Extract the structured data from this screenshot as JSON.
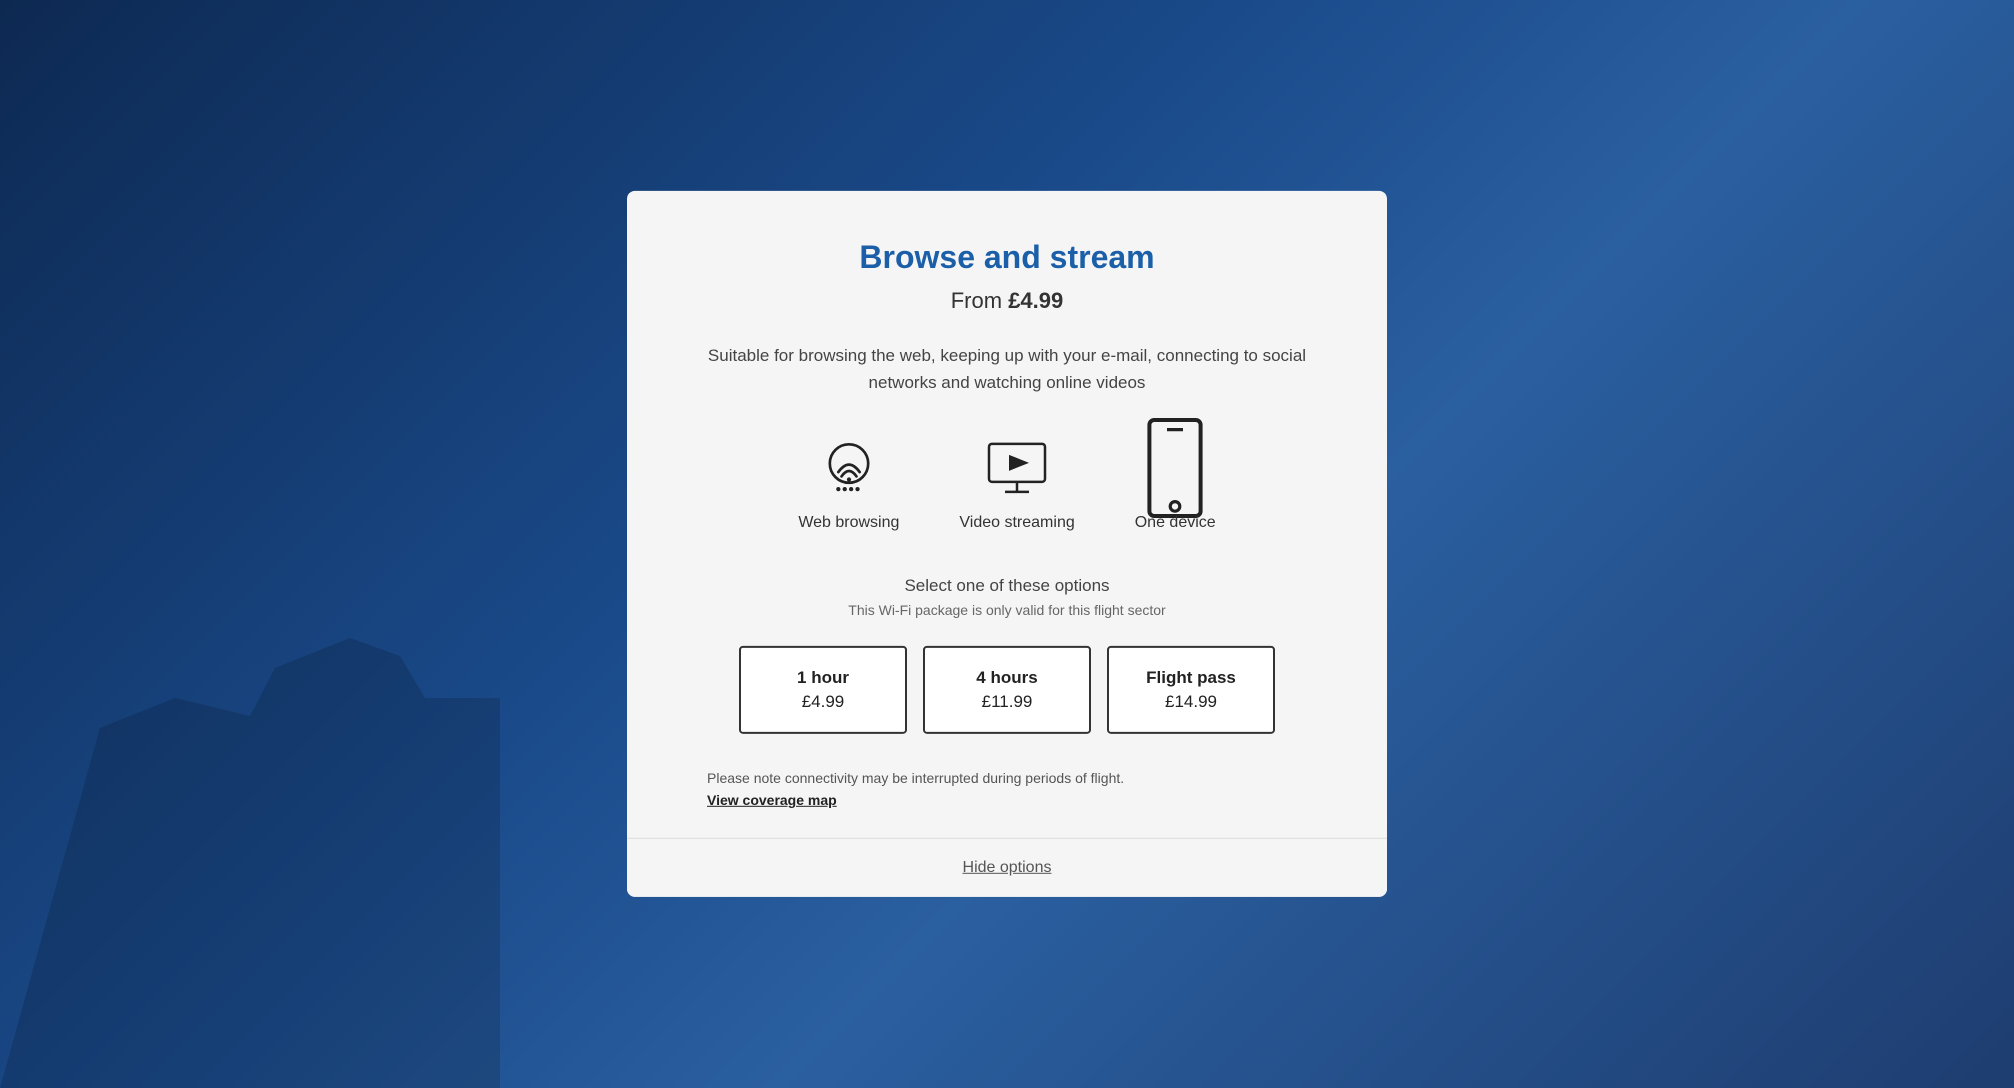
{
  "background": {
    "color": "#1a3a6b"
  },
  "modal": {
    "title": "Browse and stream",
    "price_prefix": "From ",
    "price": "£4.99",
    "description": "Suitable for browsing the web, keeping up with your e-mail, connecting to social networks and watching online videos",
    "features": [
      {
        "id": "web-browsing",
        "label": "Web browsing",
        "icon": "wifi-icon"
      },
      {
        "id": "video-streaming",
        "label": "Video streaming",
        "icon": "video-icon"
      },
      {
        "id": "one-device",
        "label": "One device",
        "icon": "device-icon"
      }
    ],
    "select_title": "Select one of these options",
    "select_subtitle": "This Wi-Fi package is only valid for this flight sector",
    "options": [
      {
        "id": "1hour",
        "duration": "1 hour",
        "price": "£4.99"
      },
      {
        "id": "4hours",
        "duration": "4 hours",
        "price": "£11.99"
      },
      {
        "id": "flight-pass",
        "duration": "Flight pass",
        "price": "£14.99"
      }
    ],
    "notice": "Please note connectivity may be interrupted during periods of flight.",
    "coverage_link": "View coverage map",
    "hide_options": "Hide options"
  }
}
